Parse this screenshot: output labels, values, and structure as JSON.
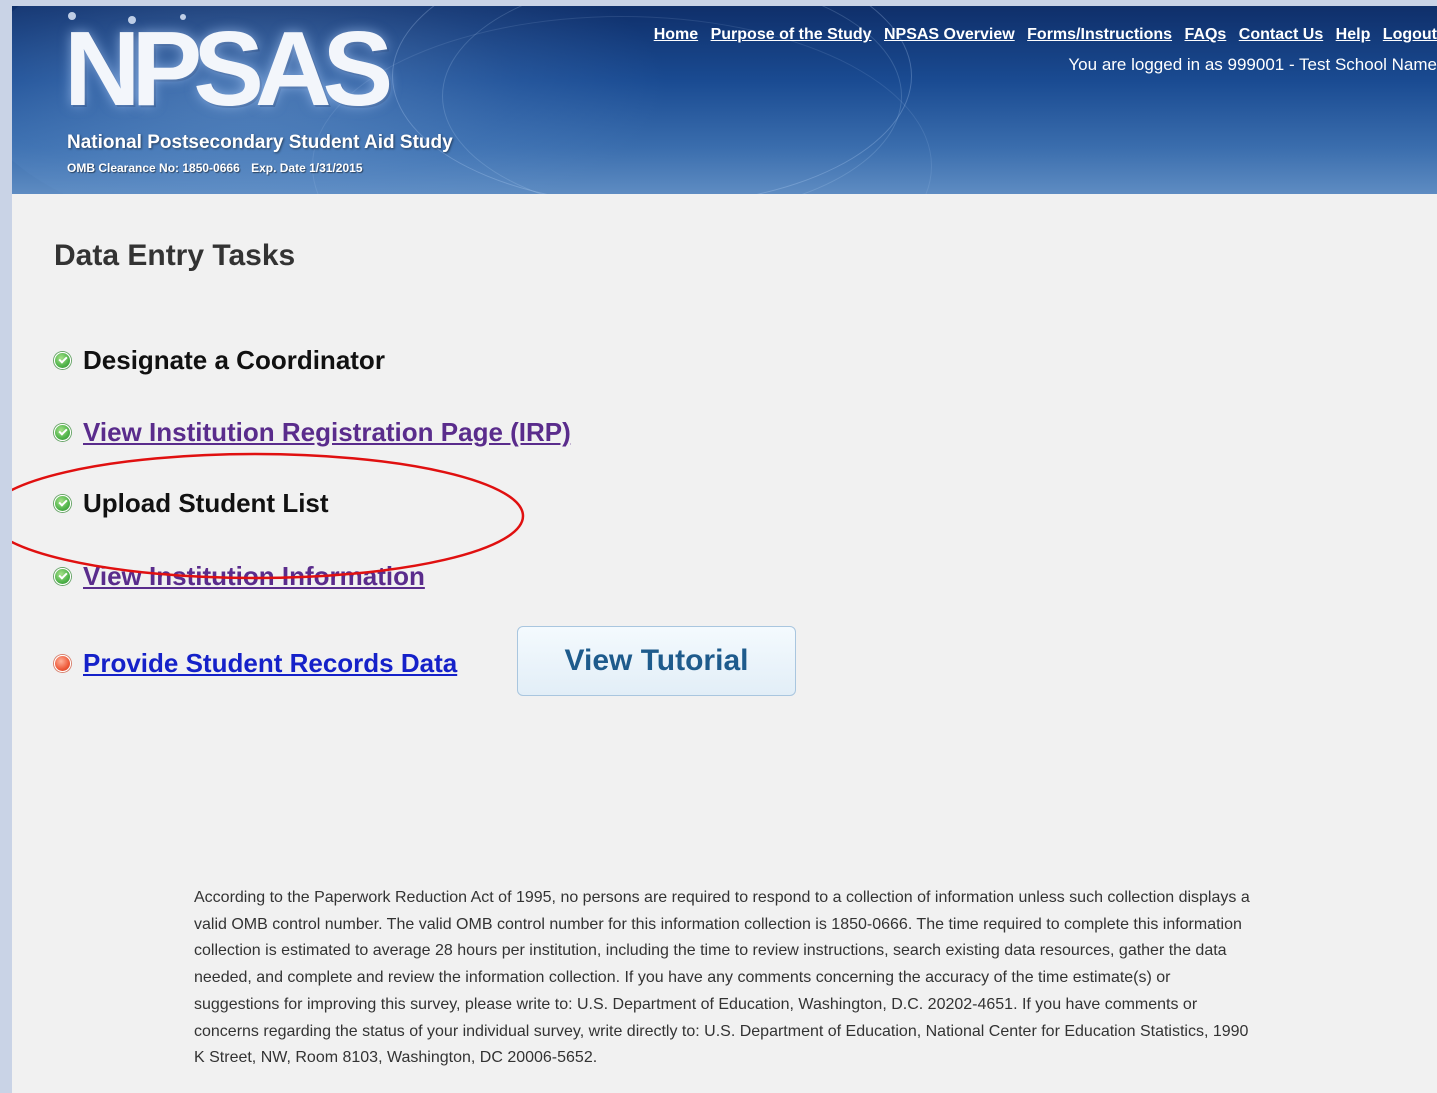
{
  "header": {
    "logo_text": "NPSAS",
    "study_name": "National Postsecondary Student Aid Study",
    "omb_clearance": "OMB Clearance No: 1850-0666",
    "exp_date": "Exp. Date 1/31/2015",
    "nav": [
      {
        "label": "Home"
      },
      {
        "label": "Purpose of the Study"
      },
      {
        "label": "NPSAS Overview"
      },
      {
        "label": "Forms/Instructions"
      },
      {
        "label": "FAQs"
      },
      {
        "label": "Contact Us"
      },
      {
        "label": "Help"
      },
      {
        "label": "Logout"
      }
    ],
    "login_status": "You are logged in as 999001 - Test School Name"
  },
  "main": {
    "title": "Data Entry Tasks",
    "tasks": [
      {
        "label": "Designate a Coordinator",
        "status": "complete",
        "link": false
      },
      {
        "label": "View Institution Registration Page (IRP)",
        "status": "complete",
        "link": true
      },
      {
        "label": "Upload Student List",
        "status": "complete",
        "link": false
      },
      {
        "label": "View Institution Information",
        "status": "complete",
        "link": true
      },
      {
        "label": "Provide Student Records Data",
        "status": "pending",
        "link": true
      }
    ],
    "tutorial_button": "View Tutorial"
  },
  "footer": {
    "paperwork_notice": "According to the Paperwork Reduction Act of 1995, no persons are required to respond to a collection of information unless such collection displays a valid OMB control number. The valid OMB control number for this information collection is 1850-0666. The time required to complete this information collection is estimated to average 28 hours per institution, including the time to review instructions, search existing data resources, gather the data needed, and complete and review the information collection. If you have any comments concerning the accuracy of the time estimate(s) or suggestions for improving this survey, please write to: U.S. Department of Education, Washington, D.C. 20202-4651. If you have comments or concerns regarding the status of your individual survey, write directly to: U.S. Department of Education, National Center for Education Statistics, 1990 K Street, NW, Room 8103, Washington, DC 20006-5652."
  },
  "colors": {
    "complete": "#4fb34a",
    "pending": "#ee5a3a",
    "visited_link": "#5a2c8c",
    "unvisited_link": "#1521c9",
    "annotation": "#e01010"
  }
}
